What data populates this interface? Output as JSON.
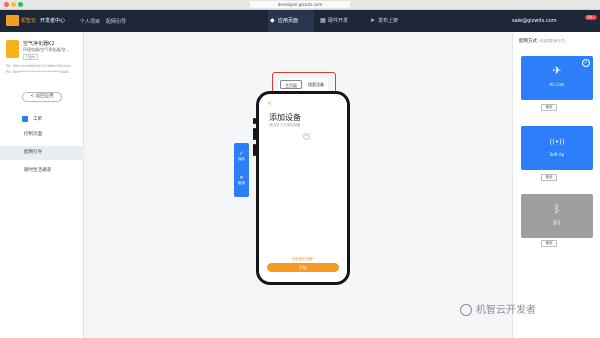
{
  "browser": {
    "url": "developer.gizwits.com"
  },
  "header": {
    "logo_text": "机智云",
    "dev_center": "开发者中心",
    "breadcrumb_project": "个人项目",
    "breadcrumb_page": "配网引导",
    "nav": [
      {
        "label": "应用页面",
        "icon": "diamond-icon"
      },
      {
        "label": "硬件开发",
        "icon": "chip-icon"
      },
      {
        "label": "发布上架",
        "icon": "send-icon"
      }
    ],
    "user_email": "sale@gizwits.com",
    "msg_badge": "99+",
    "colors": {
      "header_bg": "#1d2738",
      "accent": "#f0a020",
      "primary_blue": "#2d7ff9"
    }
  },
  "sidebar": {
    "product_name": "空气净化器K2",
    "product_category": "环境电器/空气净化器/空...",
    "product_tag": "已发布",
    "pk_label": "PK:",
    "pk_value": "9fb0c9cafe6e4e7d7fa6b0f5d2ea...",
    "ps_label": "PS:",
    "ps_value": "6e6***********************0ba6",
    "back_button": "< 返回应用",
    "section_title": "工单",
    "items": [
      {
        "label": "控制页面",
        "active": false
      },
      {
        "label": "配网引导",
        "active": true
      },
      {
        "label": "随时生活通道",
        "active": false
      }
    ]
  },
  "main": {
    "tabs": [
      {
        "label": "主页面",
        "selected": true
      },
      {
        "label": "搜索设备",
        "selected": false
      }
    ],
    "phone": {
      "back_icon": "<",
      "title": "添加设备",
      "subtitle": "请点击下方添加设备",
      "add_icon": "+",
      "link_text": "没有搜到设备?",
      "start_button": "开始"
    },
    "float_tools": [
      {
        "icon": "✓",
        "label": "保存"
      },
      {
        "icon": "✕",
        "label": "取消"
      }
    ]
  },
  "right_panel": {
    "title": "配网方式",
    "subtitle": "(可选择配网方式)",
    "use_label": "使用",
    "cards": [
      {
        "name": "Air Link",
        "icon": "airplane-icon",
        "glyph": "✈",
        "color": "#2d7ff9",
        "checked": true
      },
      {
        "name": "Soft Ap",
        "icon": "wifi-signal-icon",
        "glyph": "((•))",
        "color": "#2d7ff9",
        "checked": false
      },
      {
        "name": "蓝牙",
        "icon": "bluetooth-icon",
        "glyph": "ᛒ",
        "color": "#9e9e9e",
        "checked": false
      }
    ]
  },
  "watermark": "机智云开发者"
}
